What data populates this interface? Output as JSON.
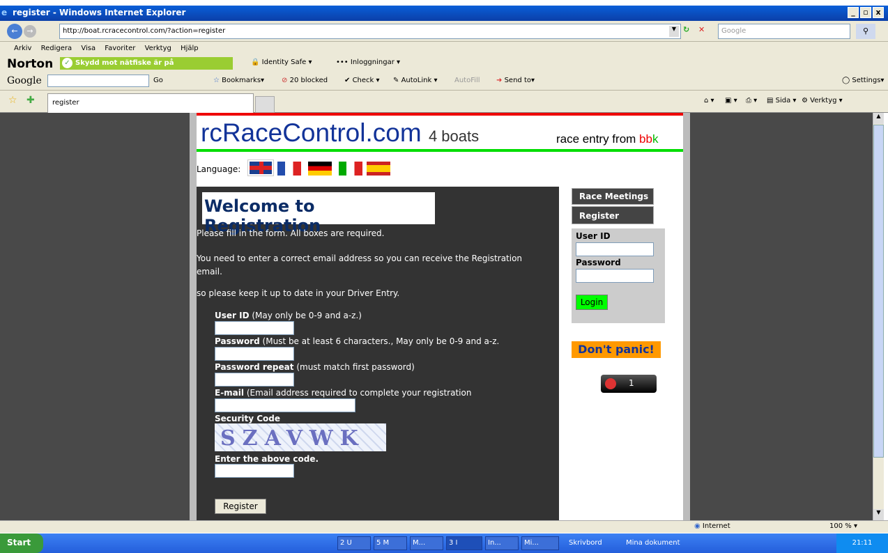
{
  "window": {
    "title": "register - Windows Internet Explorer"
  },
  "address": {
    "url": "http://boat.rcracecontrol.com/?action=register",
    "search_placeholder": "Google"
  },
  "menu": [
    "Arkiv",
    "Redigera",
    "Visa",
    "Favoriter",
    "Verktyg",
    "Hjälp"
  ],
  "norton": {
    "brand": "Norton",
    "status": "Skydd mot nätfiske är på",
    "identity": "Identity Safe",
    "logins": "Inloggningar"
  },
  "google": {
    "brand": "Google",
    "go": "Go",
    "bookmarks": "Bookmarks",
    "blocked": "20 blocked",
    "check": "Check",
    "autolink": "AutoLink",
    "autofill": "AutoFill",
    "sendto": "Send to",
    "settings": "Settings"
  },
  "tab": {
    "label": "register",
    "sida": "Sida",
    "verktyg": "Verktyg"
  },
  "page": {
    "logo": "rcRaceControl.com",
    "logo_suffix": "4 boats",
    "entry_prefix": "race entry from ",
    "entry_b1": "b",
    "entry_b2": "b",
    "entry_k": "k",
    "language_label": "Language:",
    "heading": "Welcome to Registration",
    "p1": "Please fill in the form. All boxes are required.",
    "p2": "You need to enter a correct email address so you can receive the Registration email.",
    "p3": "so please keep it up to date in your Driver Entry.",
    "f_userid": "User ID",
    "f_userid_hint": "(May only be 0-9 and a-z.)",
    "f_password": "Password",
    "f_password_hint": "(Must be at least 6 characters., May only be 0-9 and a-z.",
    "f_repeat": "Password repeat",
    "f_repeat_hint": "(must match first password)",
    "f_email": "E-mail",
    "f_email_hint": "(Email address required to complete your registration",
    "f_security": "Security Code",
    "captcha": "SZAVWK",
    "f_enter": "Enter the above code.",
    "register_button": "Register"
  },
  "side": {
    "race_meetings": "Race Meetings",
    "register": "Register",
    "userid": "User ID",
    "password": "Password",
    "login": "Login",
    "dont_panic": "Don't panic!",
    "counter": "1"
  },
  "status": {
    "zone": "Internet",
    "zoom": "100 %"
  },
  "taskbar": {
    "start": "Start",
    "items": [
      "2 U",
      "5 M",
      "M...",
      "3 I",
      "In...",
      "Mi..."
    ],
    "desktop": "Skrivbord",
    "docs": "Mina dokument",
    "clock": "21:11"
  }
}
